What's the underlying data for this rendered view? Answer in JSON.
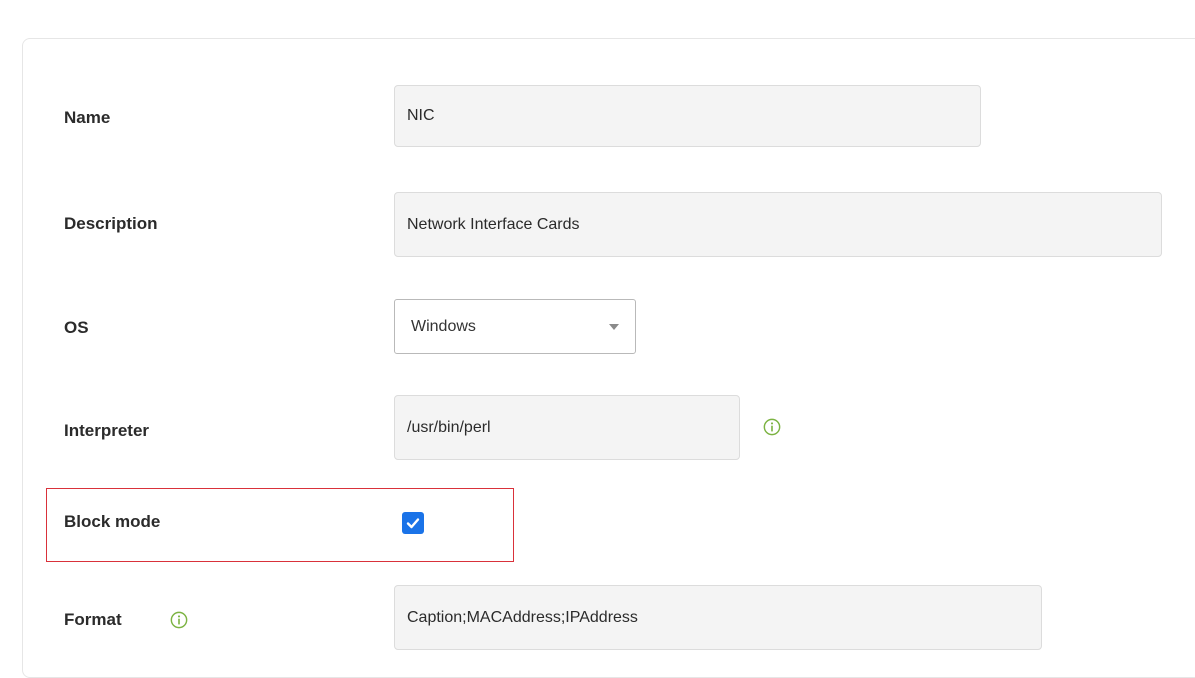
{
  "form": {
    "name": {
      "label": "Name",
      "value": "NIC"
    },
    "description": {
      "label": "Description",
      "value": "Network Interface Cards"
    },
    "os": {
      "label": "OS",
      "selected": "Windows"
    },
    "interpreter": {
      "label": "Interpreter",
      "value": "/usr/bin/perl"
    },
    "block_mode": {
      "label": "Block mode",
      "checked": true
    },
    "format": {
      "label": "Format",
      "value": "Caption;MACAddress;IPAddress"
    }
  },
  "colors": {
    "info_icon": "#7cb342",
    "checkbox": "#1a73e8",
    "highlight_border": "#d9313a"
  },
  "icons": {
    "interpreter_info": "info-icon",
    "format_info": "info-icon",
    "os_dropdown": "chevron-down-icon",
    "block_mode_check": "checkmark-icon"
  }
}
